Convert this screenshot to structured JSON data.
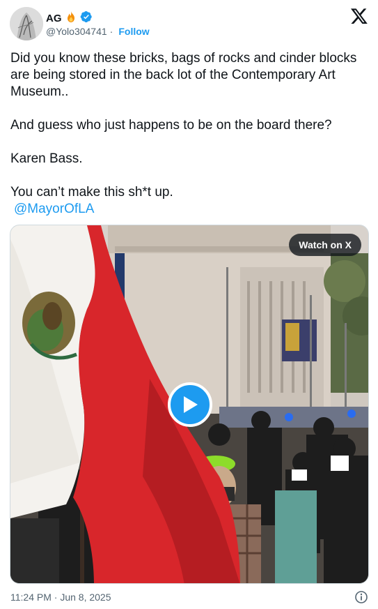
{
  "author": {
    "display_name": "AG",
    "handle": "@Yolo304741",
    "separator": "·",
    "follow_label": "Follow",
    "badges": [
      "fire-emoji",
      "verified-badge-icon"
    ]
  },
  "tweet": {
    "paragraphs": [
      "Did you know these bricks, bags of rocks and cinder blocks are being stored in the back lot of the Contemporary Art Museum..",
      "And guess who just happens to be on the board there?",
      "Karen Bass.",
      "You can’t make this sh*t up."
    ],
    "mention": "@MayorOfLA"
  },
  "media": {
    "type": "video",
    "watch_label": "Watch on X",
    "play_icon": "play-icon"
  },
  "footer": {
    "timestamp": "11:24 PM · Jun 8, 2025",
    "info_icon": "info-icon"
  },
  "colors": {
    "accent": "#1d9bf0",
    "text": "#0f1419",
    "secondary": "#536471"
  }
}
